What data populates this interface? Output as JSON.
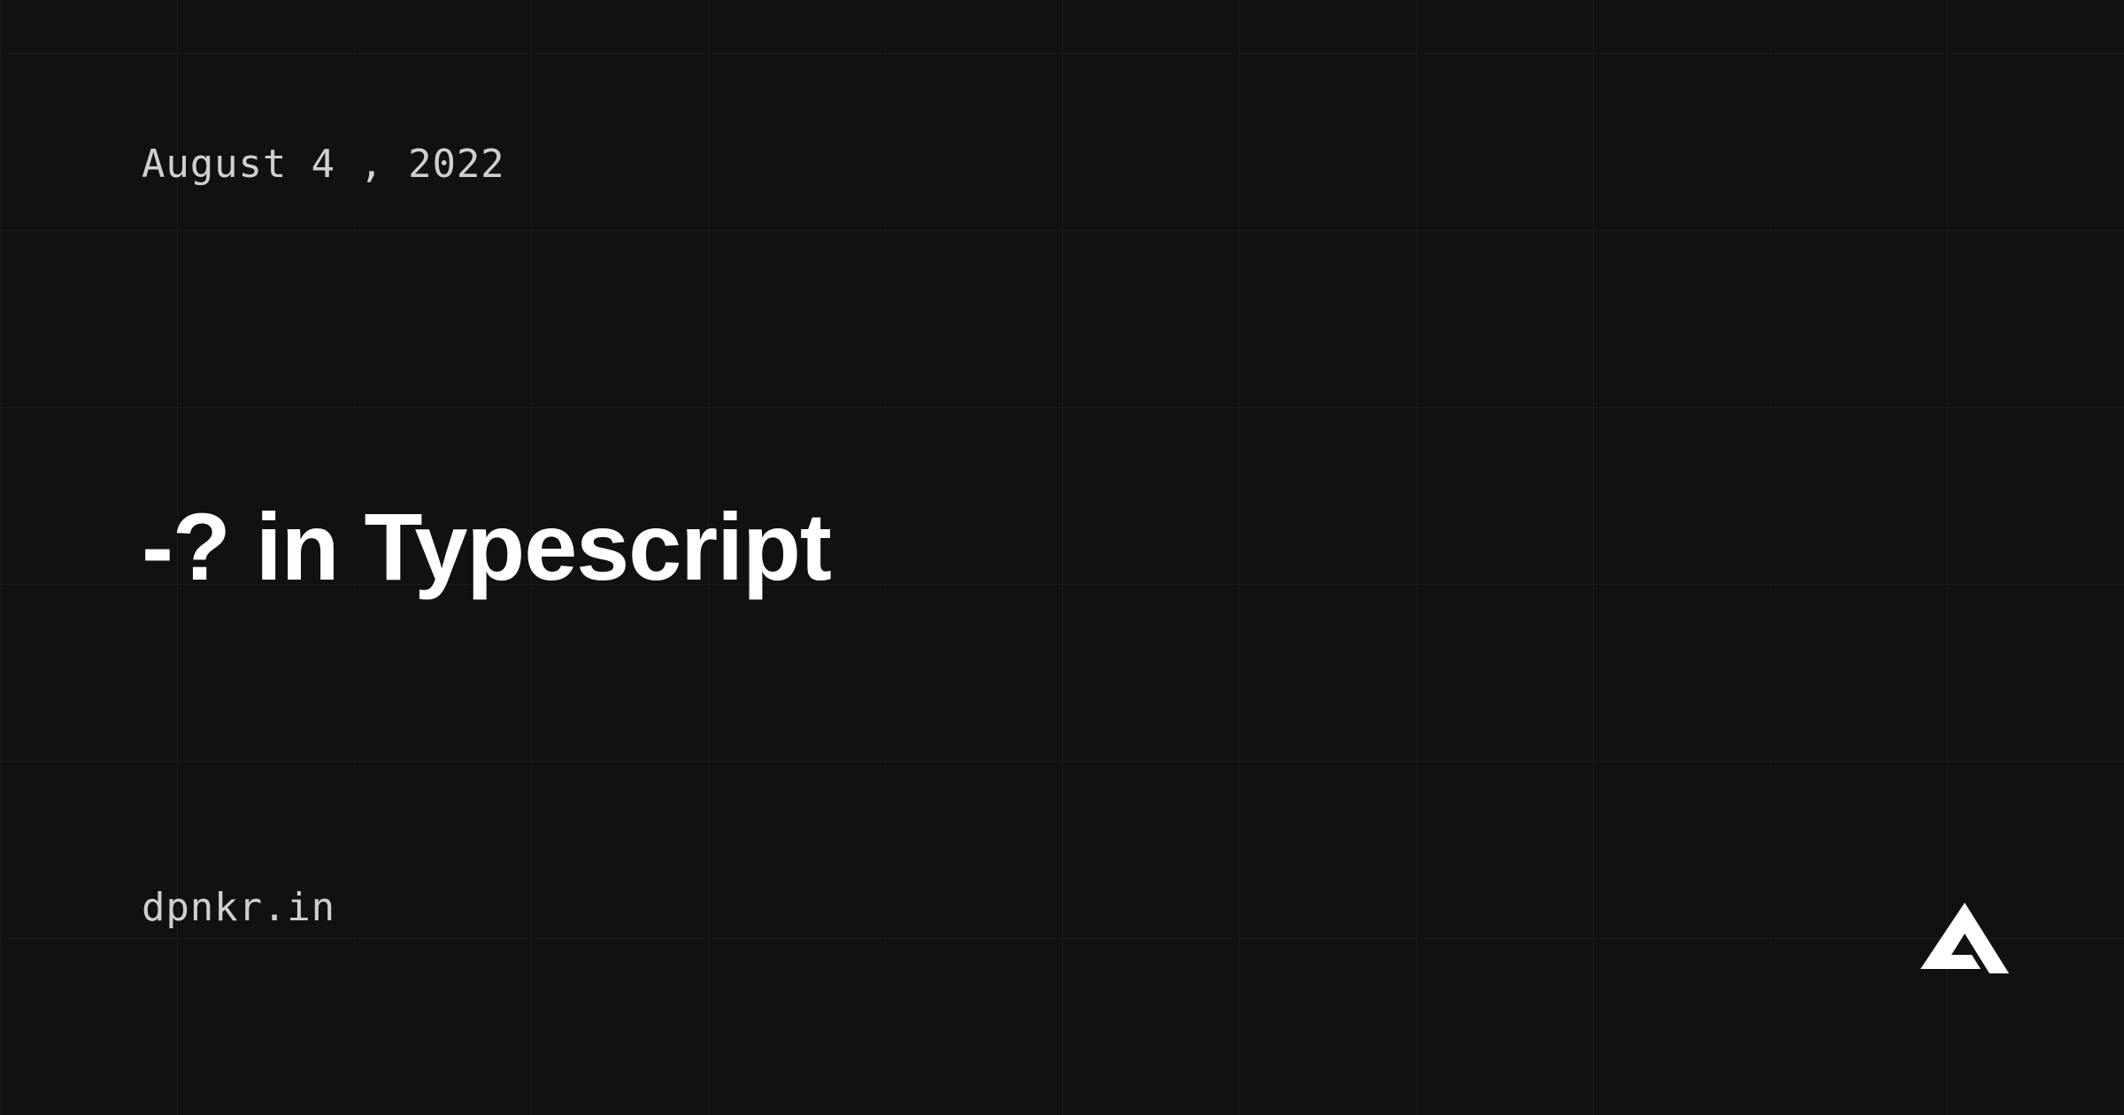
{
  "date": "August 4 , 2022",
  "title": "-? in Typescript",
  "domain": "dpnkr.in"
}
